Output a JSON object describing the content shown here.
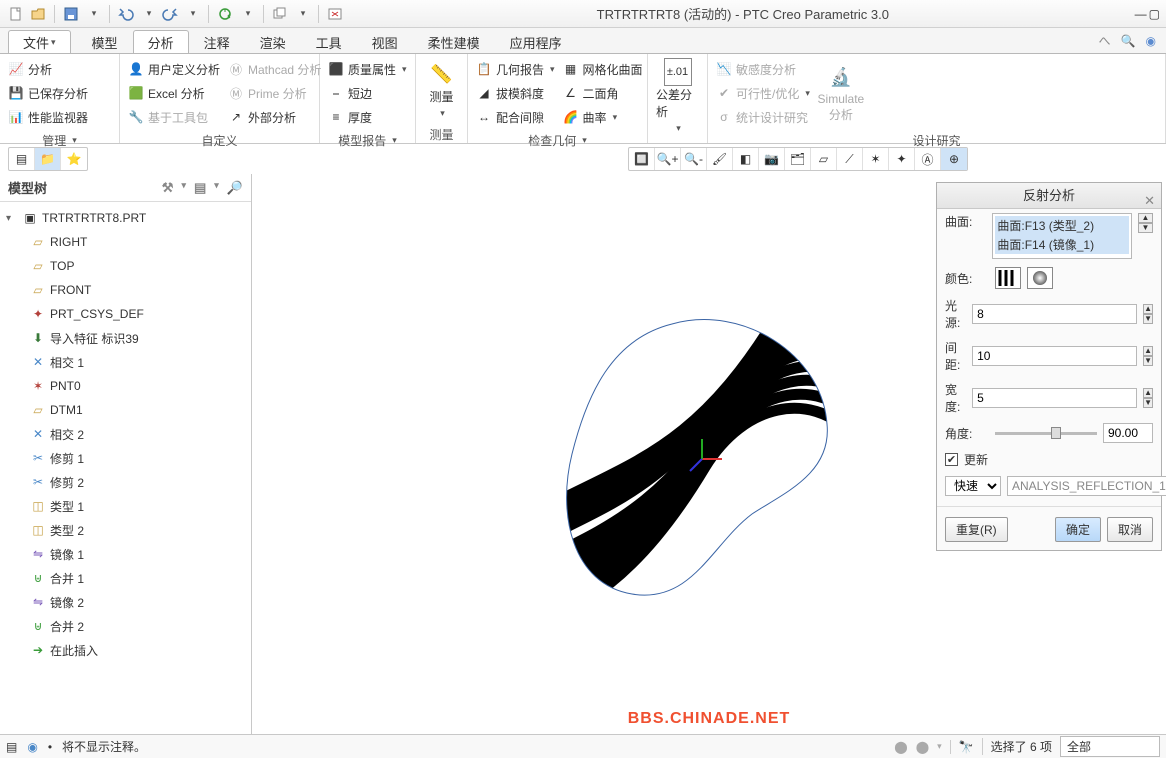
{
  "title": "TRTRTRTRT8 (活动的) - PTC Creo Parametric 3.0",
  "qat_tips": [
    "new",
    "open",
    "save",
    "undo",
    "redo",
    "regen",
    "window",
    "close"
  ],
  "menu": {
    "file": "文件",
    "tabs": [
      "模型",
      "分析",
      "注释",
      "渲染",
      "工具",
      "视图",
      "柔性建模",
      "应用程序"
    ]
  },
  "ribbon": {
    "g1": {
      "label": "管理",
      "items": [
        "分析",
        "已保存分析",
        "性能监视器"
      ]
    },
    "g2": {
      "label": "自定义",
      "items": [
        "用户定义分析",
        "Excel 分析",
        "基于工具包",
        "Mathcad 分析",
        "Prime 分析",
        "外部分析"
      ]
    },
    "g3": {
      "label": "模型报告",
      "items": [
        "质量属性",
        "短边",
        "厚度"
      ]
    },
    "g4": {
      "label": "测量",
      "big": "测量"
    },
    "g5": {
      "label": "检查几何",
      "items": [
        "几何报告",
        "拔模斜度",
        "配合间隙",
        "网格化曲面",
        "二面角",
        "曲率"
      ]
    },
    "g6": {
      "label": "",
      "big": "公差分析",
      "icon_top": "±.01"
    },
    "g7": {
      "label": "设计研究",
      "items": [
        "敏感度分析",
        "可行性/优化",
        "统计设计研究"
      ],
      "big": "Simulate",
      "big2": "分析"
    }
  },
  "tree": {
    "header": "模型树",
    "root": "TRTRTRTRT8.PRT",
    "items": [
      {
        "icon": "plane",
        "label": "RIGHT"
      },
      {
        "icon": "plane",
        "label": "TOP"
      },
      {
        "icon": "plane",
        "label": "FRONT"
      },
      {
        "icon": "csys",
        "label": "PRT_CSYS_DEF"
      },
      {
        "icon": "import",
        "label": "导入特征 标识39"
      },
      {
        "icon": "intersect",
        "label": "相交 1"
      },
      {
        "icon": "point",
        "label": "PNT0"
      },
      {
        "icon": "plane",
        "label": "DTM1"
      },
      {
        "icon": "intersect",
        "label": "相交 2"
      },
      {
        "icon": "trim",
        "label": "修剪 1"
      },
      {
        "icon": "trim",
        "label": "修剪 2"
      },
      {
        "icon": "quilt",
        "label": "类型 1"
      },
      {
        "icon": "quilt",
        "label": "类型 2"
      },
      {
        "icon": "mirror",
        "label": "镜像 1"
      },
      {
        "icon": "merge",
        "label": "合并 1"
      },
      {
        "icon": "mirror",
        "label": "镜像 2"
      },
      {
        "icon": "merge",
        "label": "合并 2"
      },
      {
        "icon": "insert",
        "label": "在此插入"
      }
    ]
  },
  "panel": {
    "title": "反射分析",
    "surf_label": "曲面:",
    "surf_items": [
      "曲面:F13 (类型_2)",
      "曲面:F14 (镜像_1)"
    ],
    "color_label": "颜色:",
    "light_label": "光源:",
    "light_val": "8",
    "spacing_label": "间距:",
    "spacing_val": "10",
    "width_label": "宽度:",
    "width_val": "5",
    "angle_label": "角度:",
    "angle_val": "90.00",
    "update": "更新",
    "mode": "快速",
    "name": "ANALYSIS_REFLECTION_1",
    "repeat": "重复(R)",
    "ok": "确定",
    "cancel": "取消"
  },
  "status": {
    "msg": "将不显示注释。",
    "sel": "选择了 6 项",
    "filter": "全部"
  },
  "watermark": "BBS.CHINADE.NET"
}
